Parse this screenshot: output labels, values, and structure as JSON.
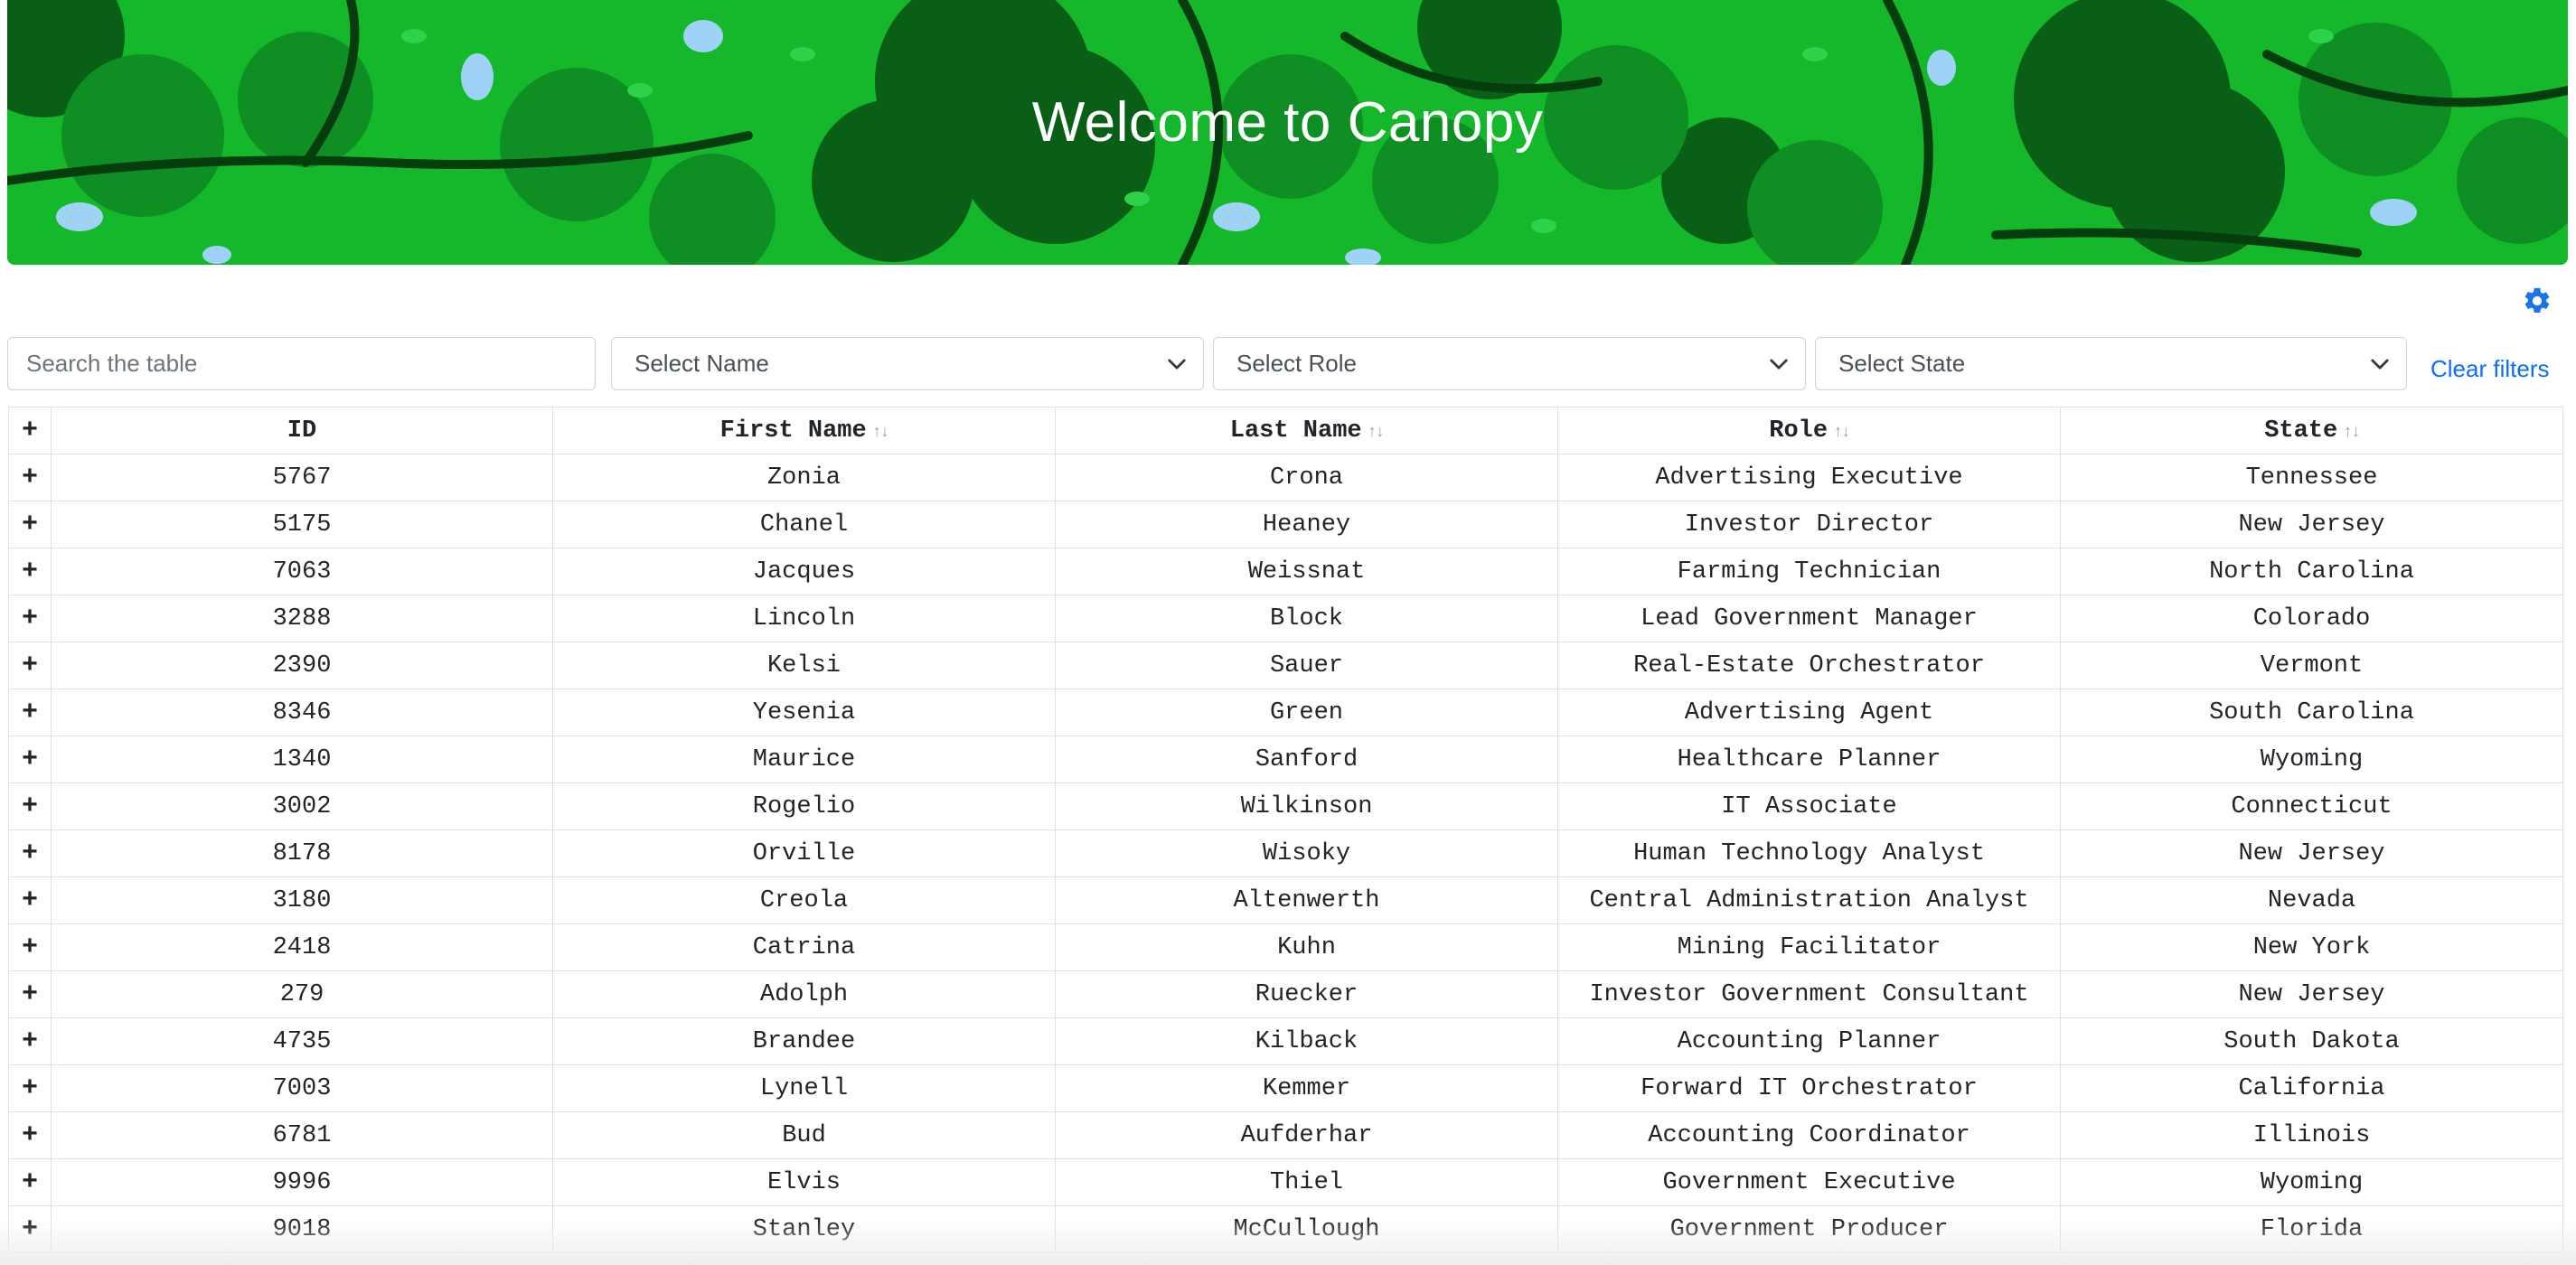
{
  "banner": {
    "title": "Welcome to Canopy"
  },
  "settings": {
    "icon": "gear-icon",
    "color": "#1a73e8"
  },
  "filters": {
    "search_placeholder": "Search the table",
    "name_select": "Select Name",
    "role_select": "Select Role",
    "state_select": "Select State",
    "clear_label": "Clear filters"
  },
  "table": {
    "expand_symbol": "+",
    "columns": [
      "ID",
      "First Name",
      "Last Name",
      "Role",
      "State"
    ],
    "rows": [
      [
        "5767",
        "Zonia",
        "Crona",
        "Advertising Executive",
        "Tennessee"
      ],
      [
        "5175",
        "Chanel",
        "Heaney",
        "Investor Director",
        "New Jersey"
      ],
      [
        "7063",
        "Jacques",
        "Weissnat",
        "Farming Technician",
        "North Carolina"
      ],
      [
        "3288",
        "Lincoln",
        "Block",
        "Lead Government Manager",
        "Colorado"
      ],
      [
        "2390",
        "Kelsi",
        "Sauer",
        "Real-Estate Orchestrator",
        "Vermont"
      ],
      [
        "8346",
        "Yesenia",
        "Green",
        "Advertising Agent",
        "South Carolina"
      ],
      [
        "1340",
        "Maurice",
        "Sanford",
        "Healthcare Planner",
        "Wyoming"
      ],
      [
        "3002",
        "Rogelio",
        "Wilkinson",
        "IT Associate",
        "Connecticut"
      ],
      [
        "8178",
        "Orville",
        "Wisoky",
        "Human Technology Analyst",
        "New Jersey"
      ],
      [
        "3180",
        "Creola",
        "Altenwerth",
        "Central Administration Analyst",
        "Nevada"
      ],
      [
        "2418",
        "Catrina",
        "Kuhn",
        "Mining Facilitator",
        "New York"
      ],
      [
        "279",
        "Adolph",
        "Ruecker",
        "Investor Government Consultant",
        "New Jersey"
      ],
      [
        "4735",
        "Brandee",
        "Kilback",
        "Accounting Planner",
        "South Dakota"
      ],
      [
        "7003",
        "Lynell",
        "Kemmer",
        "Forward IT Orchestrator",
        "California"
      ],
      [
        "6781",
        "Bud",
        "Aufderhar",
        "Accounting Coordinator",
        "Illinois"
      ],
      [
        "9996",
        "Elvis",
        "Thiel",
        "Government Executive",
        "Wyoming"
      ],
      [
        "9018",
        "Stanley",
        "McCullough",
        "Government Producer",
        "Florida"
      ]
    ]
  }
}
